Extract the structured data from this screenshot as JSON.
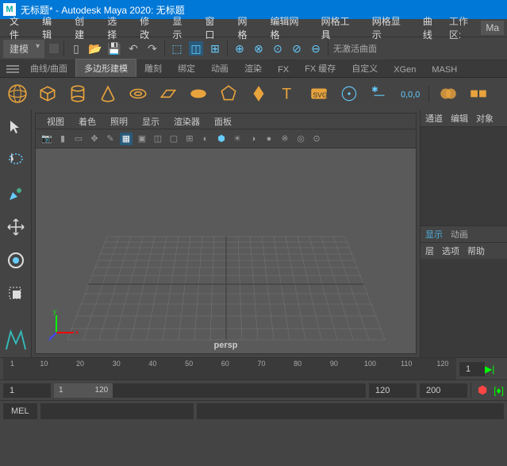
{
  "titlebar": {
    "logo": "M",
    "title": "无标题* - Autodesk Maya 2020: 无标题"
  },
  "menubar": {
    "items": [
      "文件",
      "编辑",
      "创建",
      "选择",
      "修改",
      "显示",
      "窗口",
      "网格",
      "编辑网格",
      "网格工具",
      "网格显示",
      "曲线"
    ],
    "workspace_label": "工作区:",
    "workspace_value": "Ma"
  },
  "toolbar1": {
    "mode": "建模",
    "status_right": "无激活曲面"
  },
  "shelf_tabs": [
    "曲线/曲面",
    "多边形建模",
    "雕刻",
    "绑定",
    "动画",
    "渲染",
    "FX",
    "FX 缓存",
    "自定义",
    "XGen",
    "MASH"
  ],
  "shelf_active": 1,
  "viewport": {
    "menus": [
      "视图",
      "着色",
      "照明",
      "显示",
      "渲染器",
      "面板"
    ],
    "camera": "persp"
  },
  "right_panel": {
    "top_tabs": [
      "通道",
      "编辑",
      "对象"
    ],
    "mid_tabs": [
      "显示",
      "动画"
    ],
    "sub_tabs": [
      "层",
      "选项",
      "帮助"
    ]
  },
  "timeslider": {
    "ticks": [
      "1",
      "10",
      "20",
      "30",
      "40",
      "50",
      "60",
      "70",
      "80",
      "90",
      "100",
      "110",
      "120"
    ]
  },
  "range": {
    "start_outer": "1",
    "start_inner": "1",
    "end_inner": "120",
    "end_outer": "120",
    "total": "200"
  },
  "cmdline": {
    "label": "MEL"
  },
  "colors": {
    "accent": "#e8a33d",
    "titlebar": "#0078d7"
  }
}
